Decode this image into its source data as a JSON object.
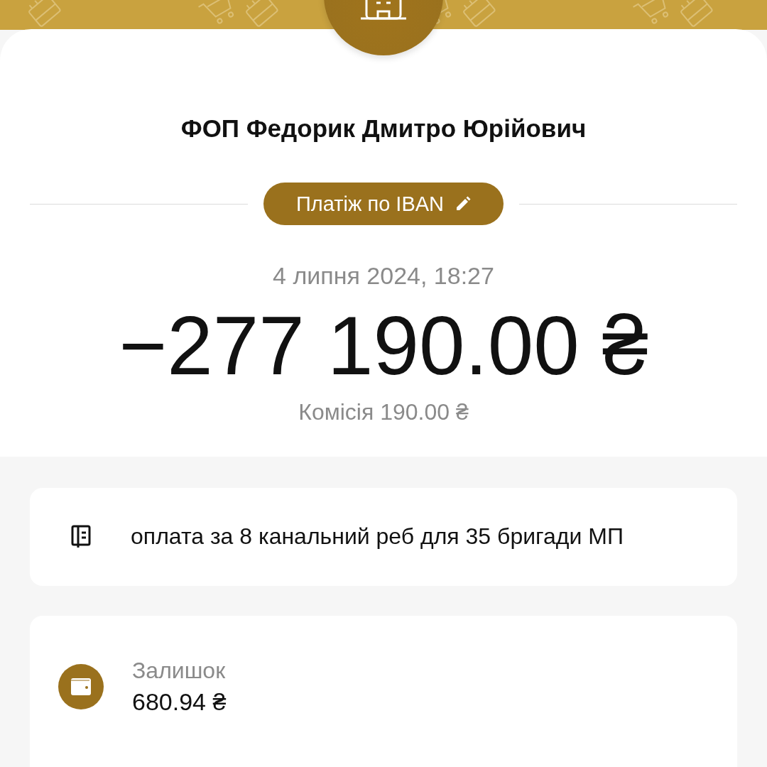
{
  "recipient": {
    "name": "ФОП Федорик Дмитро Юрійович"
  },
  "payment_type": {
    "label": "Платіж по IBAN",
    "editable": true
  },
  "date": "4 липня 2024, 18:27",
  "amount": "−277 190.00 ₴",
  "commission": "Комісія 190.00 ₴",
  "details": [
    {
      "kind": "comment",
      "text": "оплата за 8 канальний реб для 35 бригади МП"
    },
    {
      "kind": "balance",
      "label": "Залишок",
      "value": "680.94 ₴"
    }
  ]
}
